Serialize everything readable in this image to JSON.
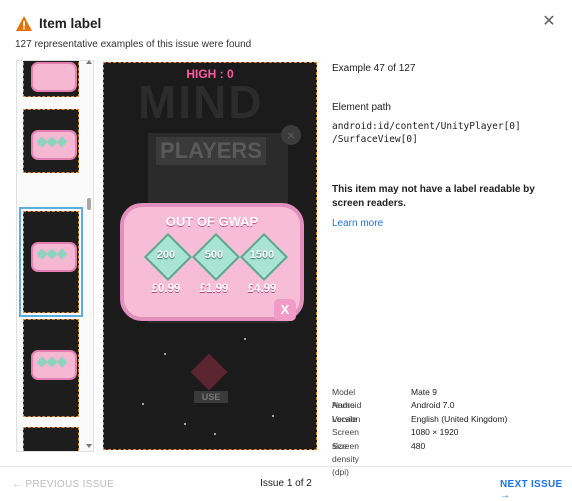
{
  "header": {
    "title": "Item label",
    "subtitle": "127 representative examples of this issue were found",
    "warning_icon": "warning-icon",
    "close_icon": "close-icon",
    "warning_color": "#e8710a"
  },
  "screenshot": {
    "high_score": "HIGH : 0",
    "background_title": "MIND",
    "players_label": "PLAYERS",
    "popup_title": "OUT OF GWAP",
    "offers": [
      {
        "amount": "200",
        "price": "£0.99"
      },
      {
        "amount": "500",
        "price": "£1.99"
      },
      {
        "amount": "1500",
        "price": "£4.99"
      }
    ],
    "popup_close": "X",
    "background_close": "×",
    "use_label": "USE",
    "highlight_color": "#e08a2a"
  },
  "details": {
    "example": "Example 47 of 127",
    "element_path_label": "Element path",
    "element_path": "android:id/content/UnityPlayer[0]\n/SurfaceView[0]",
    "message": "This item may not have a label readable by screen readers.",
    "learn_more": "Learn more",
    "properties": [
      {
        "key": "Model Name",
        "value": "Mate 9"
      },
      {
        "key": "Android Version",
        "value": "Android 7.0"
      },
      {
        "key": "Locale",
        "value": "English (United Kingdom)"
      },
      {
        "key": "Screen size",
        "value": "1080 × 1920"
      },
      {
        "key": "Screen density (dpi)",
        "value": "480"
      }
    ]
  },
  "footer": {
    "previous": "PREVIOUS ISSUE",
    "issue_counter": "Issue 1 of 2",
    "next": "NEXT ISSUE",
    "link_color": "#1a73e8"
  }
}
